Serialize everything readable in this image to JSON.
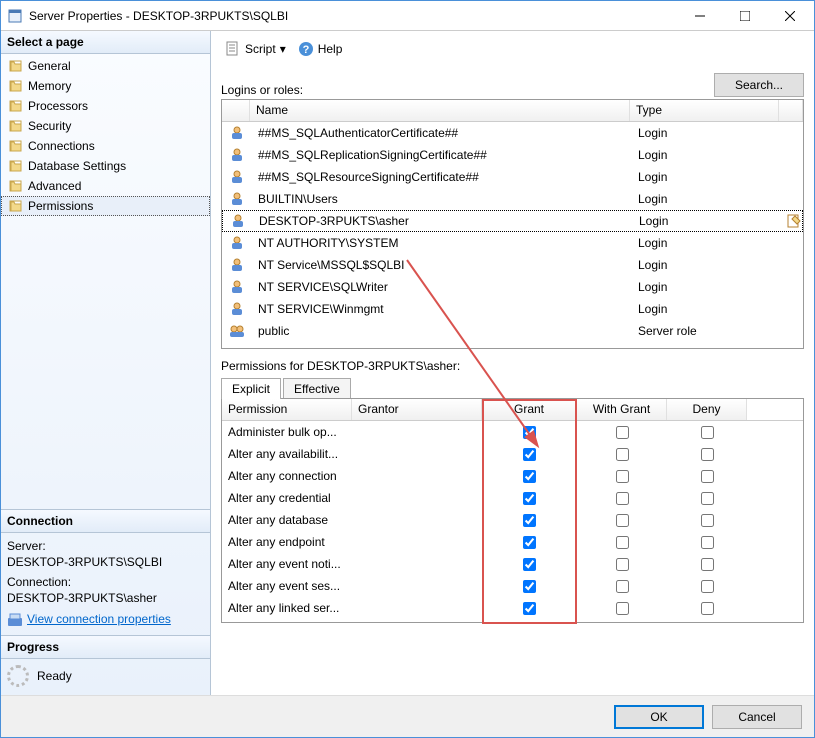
{
  "title": "Server Properties - DESKTOP-3RPUKTS\\SQLBI",
  "left": {
    "header": "Select a page",
    "items": [
      {
        "label": "General"
      },
      {
        "label": "Memory"
      },
      {
        "label": "Processors"
      },
      {
        "label": "Security"
      },
      {
        "label": "Connections"
      },
      {
        "label": "Database Settings"
      },
      {
        "label": "Advanced"
      },
      {
        "label": "Permissions",
        "selected": true
      }
    ],
    "conn_header": "Connection",
    "server_label": "Server:",
    "server_value": "DESKTOP-3RPUKTS\\SQLBI",
    "conn_label": "Connection:",
    "conn_value": "DESKTOP-3RPUKTS\\asher",
    "view_props": "View connection properties",
    "prog_header": "Progress",
    "ready": "Ready"
  },
  "toolbar": {
    "script": "Script",
    "help": "Help"
  },
  "logins_label": "Logins or roles:",
  "search": "Search...",
  "list_headers": {
    "name": "Name",
    "type": "Type"
  },
  "logins": [
    {
      "name": "##MS_SQLAuthenticatorCertificate##",
      "type": "Login",
      "icon": "login"
    },
    {
      "name": "##MS_SQLReplicationSigningCertificate##",
      "type": "Login",
      "icon": "login"
    },
    {
      "name": "##MS_SQLResourceSigningCertificate##",
      "type": "Login",
      "icon": "login"
    },
    {
      "name": "BUILTIN\\Users",
      "type": "Login",
      "icon": "login"
    },
    {
      "name": "DESKTOP-3RPUKTS\\asher",
      "type": "Login",
      "icon": "login",
      "selected": true,
      "edit": true
    },
    {
      "name": "NT AUTHORITY\\SYSTEM",
      "type": "Login",
      "icon": "login"
    },
    {
      "name": "NT Service\\MSSQL$SQLBI",
      "type": "Login",
      "icon": "login"
    },
    {
      "name": "NT SERVICE\\SQLWriter",
      "type": "Login",
      "icon": "login"
    },
    {
      "name": "NT SERVICE\\Winmgmt",
      "type": "Login",
      "icon": "login"
    },
    {
      "name": "public",
      "type": "Server role",
      "icon": "role"
    }
  ],
  "perms_label": "Permissions for DESKTOP-3RPUKTS\\asher:",
  "tabs": {
    "explicit": "Explicit",
    "effective": "Effective"
  },
  "perm_headers": {
    "perm": "Permission",
    "grantor": "Grantor",
    "grant": "Grant",
    "with": "With Grant",
    "deny": "Deny"
  },
  "permissions": [
    {
      "perm": "Administer bulk op...",
      "grant": true,
      "with": false,
      "deny": false
    },
    {
      "perm": "Alter any availabilit...",
      "grant": true,
      "with": false,
      "deny": false
    },
    {
      "perm": "Alter any connection",
      "grant": true,
      "with": false,
      "deny": false
    },
    {
      "perm": "Alter any credential",
      "grant": true,
      "with": false,
      "deny": false
    },
    {
      "perm": "Alter any database",
      "grant": true,
      "with": false,
      "deny": false
    },
    {
      "perm": "Alter any endpoint",
      "grant": true,
      "with": false,
      "deny": false
    },
    {
      "perm": "Alter any event noti...",
      "grant": true,
      "with": false,
      "deny": false
    },
    {
      "perm": "Alter any event ses...",
      "grant": true,
      "with": false,
      "deny": false
    },
    {
      "perm": "Alter any linked ser...",
      "grant": true,
      "with": false,
      "deny": false
    }
  ],
  "footer": {
    "ok": "OK",
    "cancel": "Cancel"
  }
}
